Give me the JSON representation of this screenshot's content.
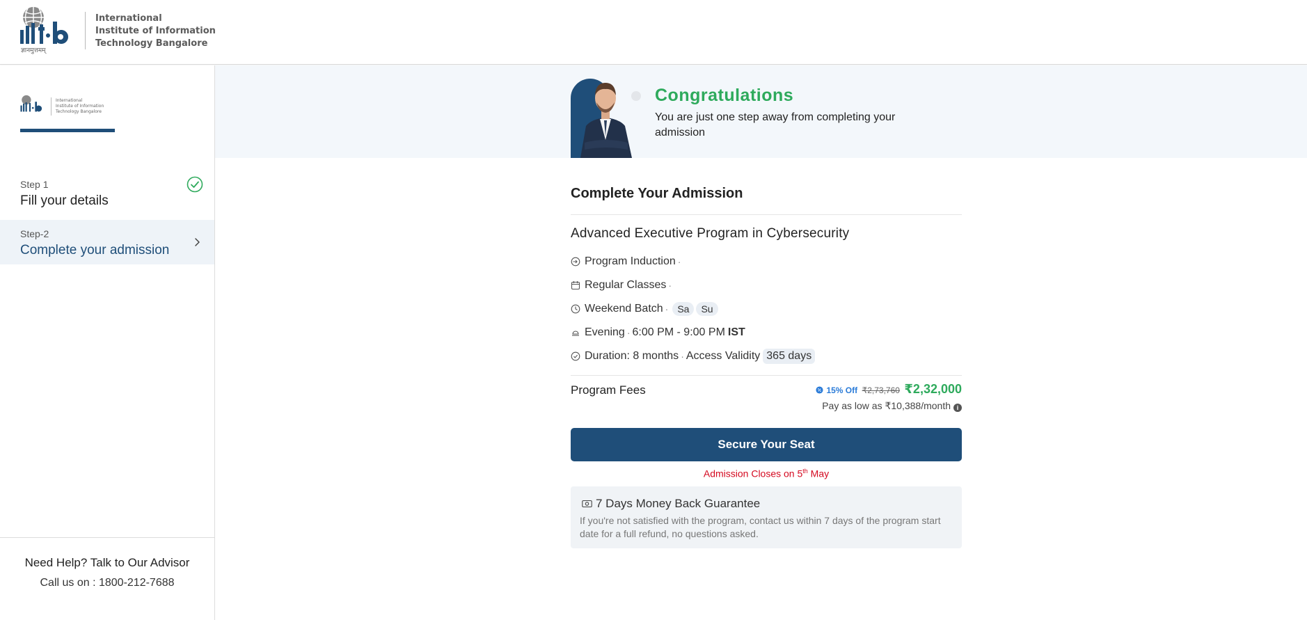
{
  "header": {
    "logo_lines": [
      "International",
      "Institute of Information",
      "Technology Bangalore"
    ],
    "logo_tagline": "ज्ञानमुत्तमम्"
  },
  "sidebar": {
    "steps": [
      {
        "number": "Step 1",
        "title": "Fill your details",
        "status": "completed",
        "icon": "check-circle-icon"
      },
      {
        "number": "Step-2",
        "title": "Complete your admission",
        "status": "active",
        "icon": "chevron-right-icon"
      }
    ],
    "help": {
      "title": "Need Help? Talk to Our Advisor",
      "call": "Call us on : 1800-212-7688"
    }
  },
  "banner": {
    "title": "Congratulations",
    "subtitle": "You are just one step away from completing your admission"
  },
  "card": {
    "title": "Complete Your Admission",
    "program_name": "Advanced Executive Program in Cybersecurity",
    "features": {
      "induction": "Program Induction",
      "classes": "Regular Classes",
      "batch": "Weekend Batch",
      "batch_days": [
        "Sa",
        "Su"
      ],
      "time_slot": "Evening",
      "time_range": "6:00 PM - 9:00 PM",
      "timezone": "IST",
      "duration": "Duration: 8 months",
      "access_label": "Access Validity",
      "access_value": "365 days"
    },
    "fees": {
      "label": "Program Fees",
      "discount": "15% Off",
      "original_price": "₹2,73,760",
      "price": "₹2,32,000",
      "emi": "Pay as low as ₹10,388/month"
    },
    "cta_label": "Secure Your Seat",
    "closing": {
      "prefix": "Admission Closes on 5",
      "sup": "th",
      "suffix": " May"
    },
    "guarantee": {
      "title": "7 Days Money Back Guarantee",
      "body": "If you're not satisfied with the program, contact us within 7 days of the program start date for a full refund, no questions asked."
    }
  },
  "colors": {
    "brand_blue": "#1f4e79",
    "success_green": "#2eaa5c",
    "alert_red": "#d4081f",
    "discount_blue": "#2a7bd8"
  }
}
